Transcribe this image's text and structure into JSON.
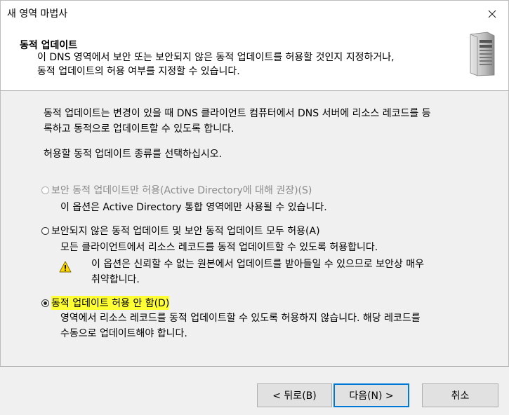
{
  "window": {
    "title": "새 영역 마법사"
  },
  "header": {
    "title": "동적 업데이트",
    "description_line1": "이 DNS 영역에서 보안 또는 보안되지 않은 동적 업데이트를 허용할 것인지 지정하거나,",
    "description_line2": "동적 업데이트의 허용 여부를 지정할 수 있습니다."
  },
  "intro": {
    "line1": "동적 업데이트는 변경이 있을 때 DNS 클라이언트 컴퓨터에서 DNS 서버에 리소스 레코드를 등",
    "line2": "록하고 동적으로 업데이트할 수 있도록 합니다.",
    "prompt": "허용할 동적 업데이트 종류를 선택하십시오."
  },
  "options": [
    {
      "label": "보안 동적 업데이트만 허용(Active Directory에 대해 권장)(S)",
      "description": "이 옵션은 Active Directory 통합 영역에만 사용될 수 있습니다.",
      "enabled": false,
      "selected": false
    },
    {
      "label": "보안되지 않은 동적 업데이트 및 보안 동적 업데이트 모두 허용(A)",
      "description": "모든 클라이언트에서 리소스 레코드를 동적 업데이트할 수 있도록 허용합니다.",
      "warning_line1": "이 옵션은 신뢰할 수 없는 원본에서 업데이트를 받아들일 수 있으므로 보안상 매우",
      "warning_line2": "취약합니다.",
      "enabled": true,
      "selected": false
    },
    {
      "label": "동적 업데이트 허용 안 함(D)",
      "description_line1": "영역에서 리소스 레코드를 동적 업데이트할 수 있도록 허용하지 않습니다. 해당 레코드를",
      "description_line2": "수동으로 업데이트해야 합니다.",
      "enabled": true,
      "selected": true
    }
  ],
  "buttons": {
    "back": "< 뒤로(B)",
    "next": "다음(N) >",
    "cancel": "취소"
  },
  "icons": {
    "close": "close-icon",
    "server": "server-icon",
    "warning": "warning-icon"
  },
  "colors": {
    "highlight": "#ffff33",
    "default_button_border": "#0078d7",
    "warning": "#ffd700"
  }
}
